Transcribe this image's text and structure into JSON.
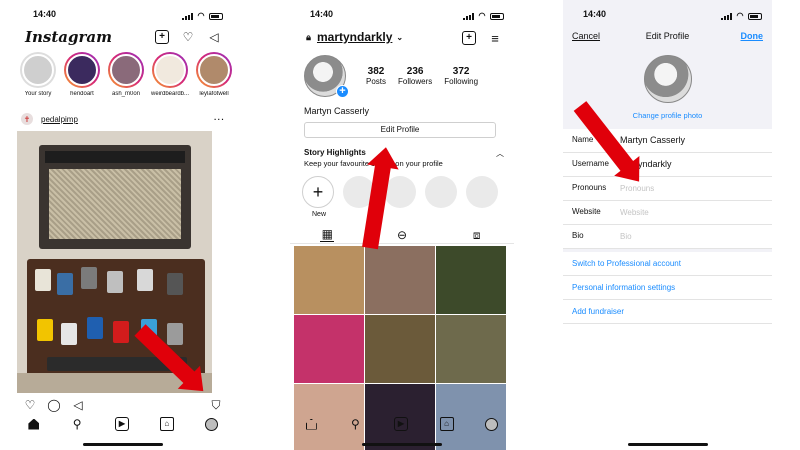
{
  "status_time": "14:40",
  "feed": {
    "logo": "Instagram",
    "stories": [
      {
        "name": "Your story",
        "color": "#cfcfcf",
        "ring": false
      },
      {
        "name": "hendoart",
        "color": "#3b2a5e",
        "ring": true
      },
      {
        "name": "ash_m0on",
        "color": "#8a6a7a",
        "ring": true
      },
      {
        "name": "weirdbeardb...",
        "color": "#f1e9de",
        "ring": true
      },
      {
        "name": "leylafotwell",
        "color": "#b08a6b",
        "ring": true
      }
    ],
    "post_user": "pedalpimp",
    "post_more": "···"
  },
  "profile": {
    "username": "martyndarkly",
    "stats": [
      {
        "num": "382",
        "label": "Posts"
      },
      {
        "num": "236",
        "label": "Followers"
      },
      {
        "num": "372",
        "label": "Following"
      }
    ],
    "full_name": "Martyn Casserly",
    "edit_button": "Edit Profile",
    "highlights_title": "Story Highlights",
    "highlights_sub": "Keep your favourite stories on your profile",
    "new_label": "New",
    "grid_colors": [
      "#b89060",
      "#8b6f60",
      "#3d4a2a",
      "#c4326a",
      "#6b5a3a",
      "#6e6a4c",
      "#cfa590",
      "#2b2030",
      "#7f92ad"
    ]
  },
  "edit": {
    "cancel": "Cancel",
    "title": "Edit Profile",
    "done": "Done",
    "change_photo": "Change profile photo",
    "fields": [
      {
        "label": "Name",
        "value": "Martyn Casserly",
        "placeholder": false
      },
      {
        "label": "Username",
        "value": "martyndarkly",
        "placeholder": false
      },
      {
        "label": "Pronouns",
        "value": "Pronouns",
        "placeholder": true
      },
      {
        "label": "Website",
        "value": "Website",
        "placeholder": true
      },
      {
        "label": "Bio",
        "value": "Bio",
        "placeholder": true
      }
    ],
    "links": [
      "Switch to Professional account",
      "Personal information settings",
      "Add fundraiser"
    ]
  },
  "colors": {
    "accent": "#1a8cff",
    "arrow": "#e0000a"
  }
}
